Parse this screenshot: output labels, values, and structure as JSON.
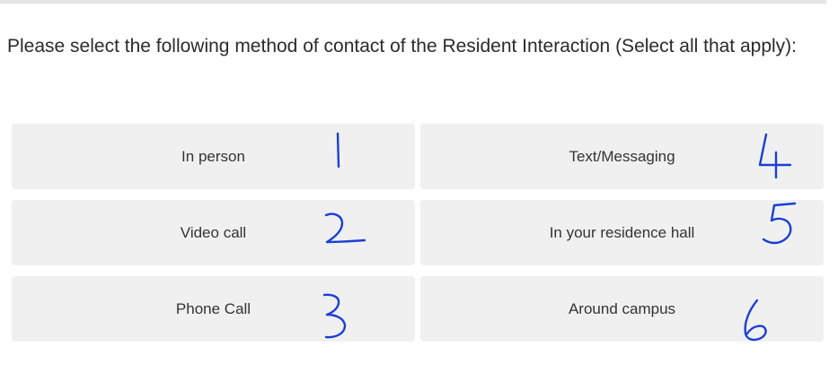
{
  "question": {
    "text": "Please select the following method of contact of the Resident Interaction (Select all that apply):"
  },
  "choices": [
    {
      "label": "In person"
    },
    {
      "label": "Text/Messaging"
    },
    {
      "label": "Video call"
    },
    {
      "label": "In your residence hall"
    },
    {
      "label": "Phone Call"
    },
    {
      "label": "Around campus"
    }
  ],
  "handwritten_numbers": [
    "1",
    "2",
    "3",
    "4",
    "5",
    "6"
  ],
  "colors": {
    "choice_background": "#f0f0f0",
    "ink": "#1a3fd6",
    "divider": "#e4e4e4"
  }
}
